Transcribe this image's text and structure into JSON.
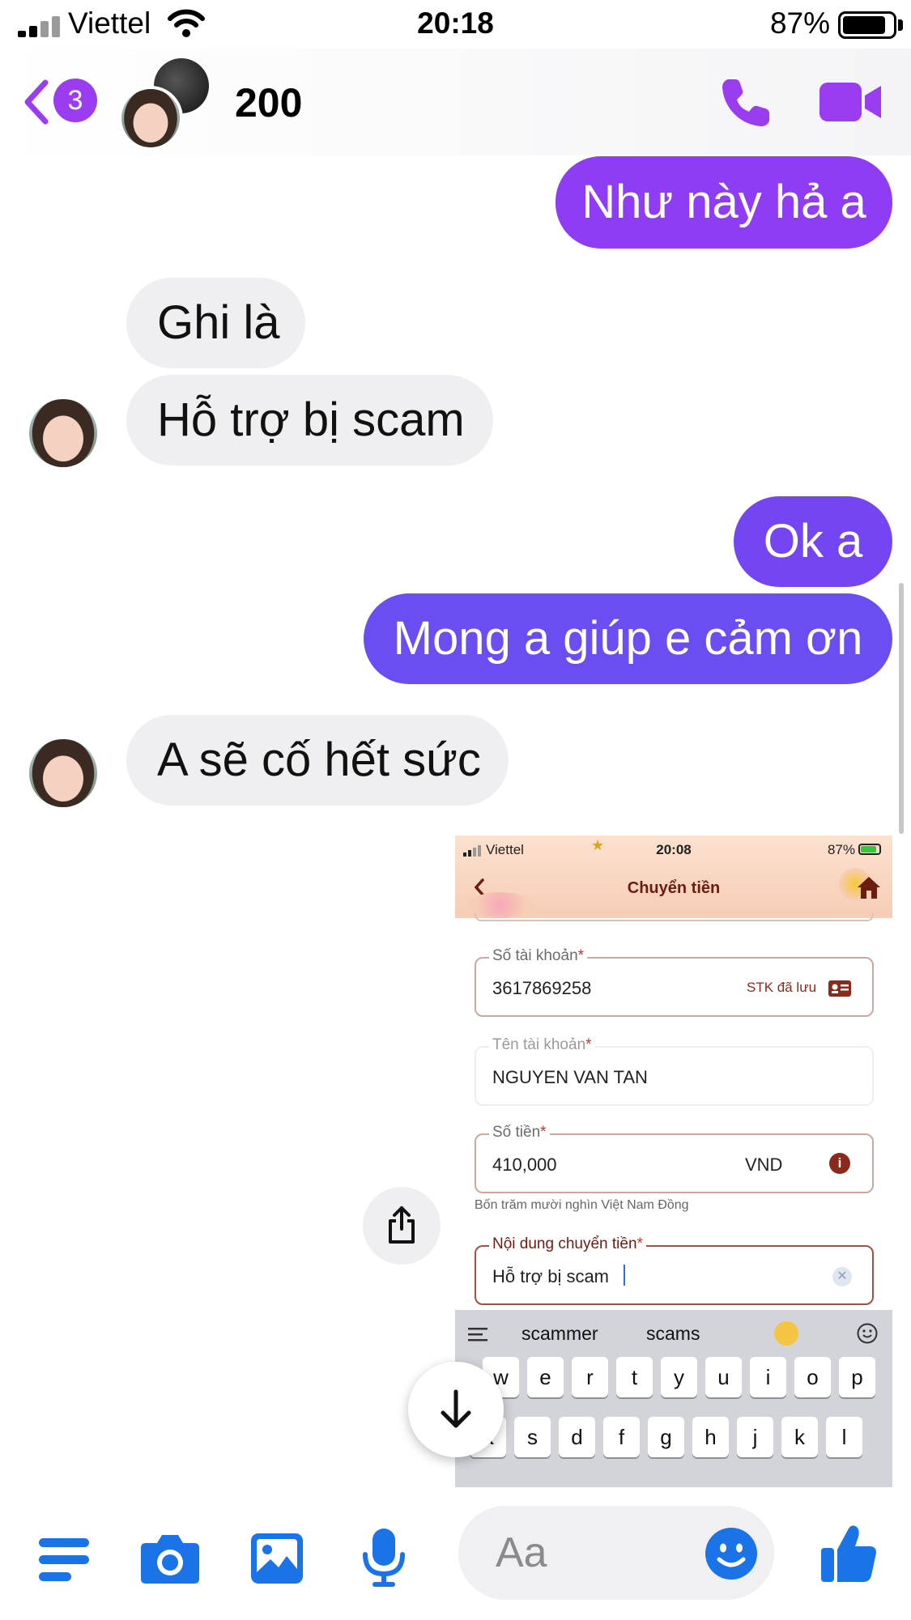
{
  "status_bar": {
    "carrier": "Viettel",
    "time": "20:18",
    "battery": "87%"
  },
  "header": {
    "back_badge_count": "3",
    "contact_name": "200"
  },
  "messages": [
    {
      "side": "out",
      "text": "Như này hả a"
    },
    {
      "side": "in",
      "text": "Ghi là"
    },
    {
      "side": "in",
      "text": "Hỗ trợ bị scam"
    },
    {
      "side": "out",
      "text": "Ok a"
    },
    {
      "side": "out",
      "text": "Mong a giúp e cảm ơn"
    },
    {
      "side": "in",
      "text": "A sẽ cố hết sức"
    }
  ],
  "shared_screenshot": {
    "carrier": "Viettel",
    "time": "20:08",
    "battery": "87%",
    "title": "Chuyển tiền",
    "account_number_label": "Số tài khoản",
    "account_number": "3617869258",
    "saved_accounts": "STK đã lưu",
    "account_name_label": "Tên tài khoản",
    "account_name": "NGUYEN VAN TAN",
    "amount_label": "Số tiền",
    "amount": "410,000",
    "currency": "VND",
    "amount_in_words": "Bốn trăm mười nghìn Việt Nam Đồng",
    "content_label": "Nội dung chuyển tiền",
    "content": "Hỗ trợ bị scam",
    "required_mark": "*",
    "suggestions": [
      "scammer",
      "scams"
    ],
    "keyboard_row1": [
      "w",
      "e",
      "r",
      "t",
      "y",
      "u",
      "i",
      "o",
      "p"
    ],
    "keyboard_row2": [
      "a",
      "s",
      "d",
      "f",
      "g",
      "h",
      "j",
      "k",
      "l"
    ]
  },
  "composer": {
    "placeholder": "Aa"
  },
  "colors": {
    "accent_purple": "#9a3df0",
    "bubble_purple": "#8f3cf5",
    "bubble_indigo": "#6a4ef2",
    "incoming_bubble": "#efeff1",
    "composer_blue": "#1b73e8"
  }
}
